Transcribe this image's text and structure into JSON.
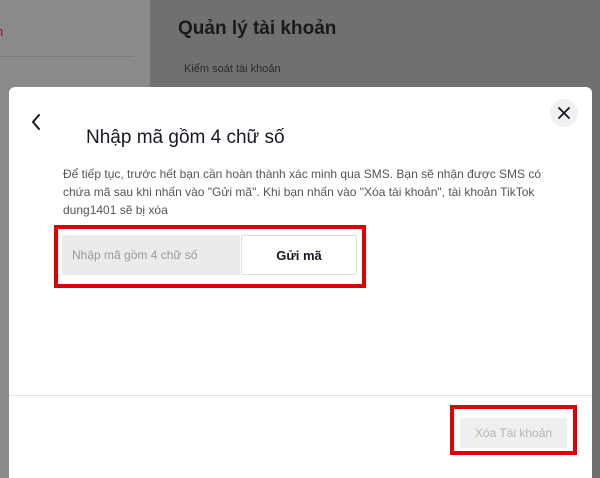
{
  "background": {
    "left_text": "n",
    "title": "Quản lý tài khoản",
    "subtitle": "Kiểm soát tài khoản"
  },
  "modal": {
    "title": "Nhập mã gồm 4 chữ số",
    "description": "Để tiếp tục, trước hết bạn cần hoàn thành xác minh qua SMS. Bạn sẽ nhận được SMS có chứa mã sau khi nhấn vào \"Gửi mã\". Khi bạn nhấn vào \"Xóa tài khoản\", tài khoản TikTok dung1401 sẽ bị xóa",
    "code_placeholder": "Nhập mã gồm 4 chữ số",
    "code_value": "",
    "send_code_label": "Gửi mã",
    "delete_account_label": "Xóa Tài khoản"
  },
  "icons": {
    "back": "chevron-left-icon",
    "close": "close-icon"
  },
  "colors": {
    "highlight": "#e00000",
    "overlay": "#6e6e6e",
    "disabled_button_bg": "#efefef",
    "disabled_button_text": "#b5b5b5"
  }
}
